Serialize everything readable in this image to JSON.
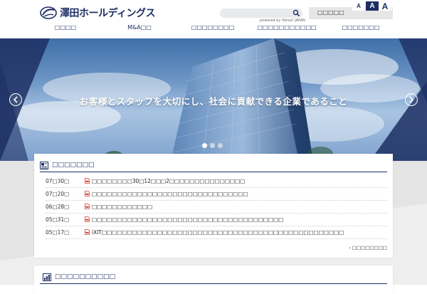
{
  "header": {
    "logo_text": "澤田ホールディングス",
    "search": {
      "placeholder": "",
      "value": ""
    },
    "powered_by": "powered by Yahoo! JAPAN",
    "font_size": {
      "label": "□□□□□",
      "small": "A",
      "medium": "A",
      "large": "A"
    }
  },
  "nav": {
    "items": [
      {
        "label": "□□□□"
      },
      {
        "label": "M&A□□"
      },
      {
        "label": "□□□□□□□□"
      },
      {
        "label": "□□□□□□□□□□□"
      },
      {
        "label": "□□□□□□□"
      }
    ]
  },
  "hero": {
    "caption": "お客様とスタッフを大切にし、社会に貢献できる企業であること",
    "slides": 3,
    "active_slide": 0
  },
  "news": {
    "title": "□□□□□□□",
    "items": [
      {
        "date": "07□30□",
        "text": "□□□□□□□□30□12□□□2□□□□□□□□□□□□□□□"
      },
      {
        "date": "07□20□",
        "text": "□□□□□□□□□□□□□□□□□□□□□□□□□□□□□□□"
      },
      {
        "date": "06□28□",
        "text": "□□□□□□□□□□□□"
      },
      {
        "date": "05□31□",
        "text": "□□□□□□□□□□□□□□□□□□□□□□□□□□□□□□□□□□□□□□"
      },
      {
        "date": "05□17□",
        "text": "iXIT□□□□□□□□□□□□□□□□□□□□□□□□□□□□□□□□□□□□□□□□□□□□□□□□"
      }
    ],
    "more_label": "□□□□□□□□"
  },
  "ir": {
    "title": "□□□□□□□□□□"
  },
  "colors": {
    "brand_navy": "#1d2f63",
    "pdf_red": "#d23b2f",
    "panel_bg": "#efefef"
  },
  "icons": {
    "search": "search-icon",
    "pdf": "pdf-icon",
    "news": "news-icon",
    "ir": "chart-icon",
    "arrow_left": "chevron-left-icon",
    "arrow_right": "chevron-right-icon"
  }
}
